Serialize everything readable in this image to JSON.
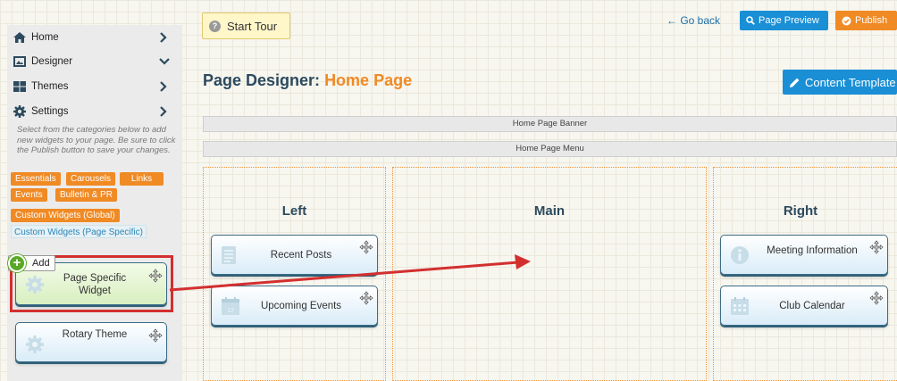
{
  "sidebar": {
    "nav": [
      {
        "label": "Home",
        "icon": "home-icon",
        "chevron": "right"
      },
      {
        "label": "Designer",
        "icon": "designer-icon",
        "chevron": "down"
      },
      {
        "label": "Themes",
        "icon": "themes-icon",
        "chevron": "right"
      },
      {
        "label": "Settings",
        "icon": "gear-icon",
        "chevron": "right"
      }
    ],
    "help_text": "Select from the categories below to add new widgets to your page. Be sure to click the Publish button to save your changes.",
    "categories": [
      "Essentials",
      "Carousels",
      "Links",
      "Events",
      "Bulletin & PR",
      "Custom Widgets (Global)"
    ],
    "active_category": "Custom Widgets (Page Specific)",
    "add_label": "Add",
    "widgets": [
      {
        "title_line1": "Page Specific",
        "title_line2": "Widget"
      },
      {
        "title_line1": "Rotary Theme"
      }
    ]
  },
  "header": {
    "start_tour": "Start Tour",
    "go_back": "Go back",
    "page_preview": "Page Preview",
    "publish": "Publish"
  },
  "designer": {
    "title_prefix": "Page Designer:",
    "title_page": "Home Page",
    "content_template": "Content Template",
    "banner": "Home Page Banner",
    "menu": "Home Page Menu",
    "zones": {
      "left": {
        "title": "Left",
        "widgets": [
          "Recent Posts",
          "Upcoming Events"
        ]
      },
      "main": {
        "title": "Main"
      },
      "right": {
        "title": "Right",
        "widgets": [
          "Meeting Information",
          "Club Calendar"
        ]
      }
    }
  },
  "colors": {
    "accent_orange": "#f08a24",
    "accent_blue": "#1a8fd6",
    "highlight_red": "#d32f2f",
    "title_navy": "#2c4a5e"
  }
}
